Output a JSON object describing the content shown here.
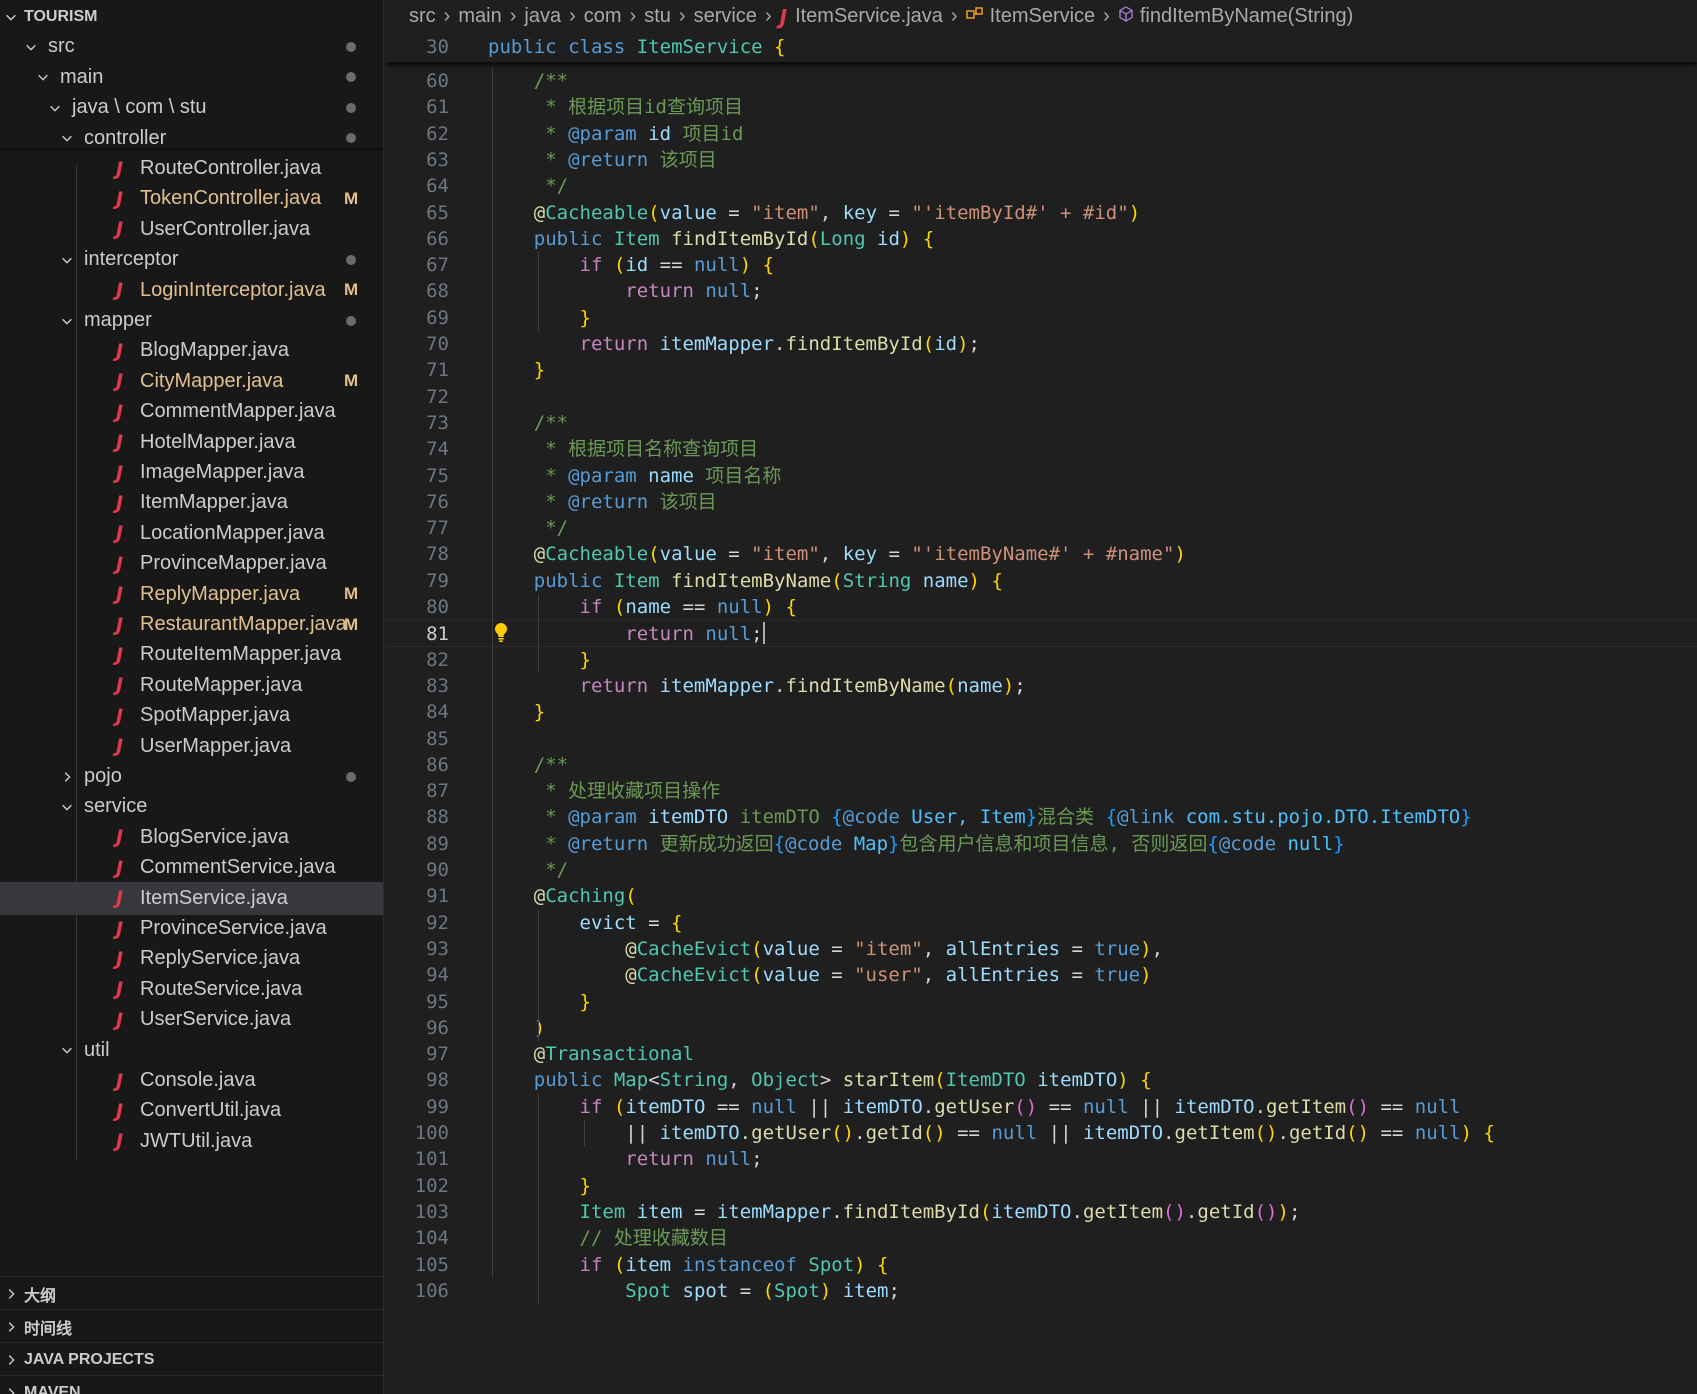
{
  "explorer": {
    "root": "TOURISM",
    "items": [
      {
        "label": "src",
        "kind": "folder",
        "open": true,
        "dot": true
      },
      {
        "label": "main",
        "kind": "folder",
        "open": true,
        "dot": true
      },
      {
        "label": "java \\ com \\ stu",
        "kind": "folder",
        "open": true,
        "dot": true
      },
      {
        "label": "controller",
        "kind": "folder",
        "open": true,
        "dot": true
      },
      {
        "label": "RouteController.java",
        "kind": "java"
      },
      {
        "label": "TokenController.java",
        "kind": "java",
        "badge": "M"
      },
      {
        "label": "UserController.java",
        "kind": "java"
      },
      {
        "label": "interceptor",
        "kind": "folder",
        "open": true,
        "dot": true
      },
      {
        "label": "LoginInterceptor.java",
        "kind": "java",
        "badge": "M"
      },
      {
        "label": "mapper",
        "kind": "folder",
        "open": true,
        "dot": true
      },
      {
        "label": "BlogMapper.java",
        "kind": "java"
      },
      {
        "label": "CityMapper.java",
        "kind": "java",
        "badge": "M"
      },
      {
        "label": "CommentMapper.java",
        "kind": "java"
      },
      {
        "label": "HotelMapper.java",
        "kind": "java"
      },
      {
        "label": "ImageMapper.java",
        "kind": "java"
      },
      {
        "label": "ItemMapper.java",
        "kind": "java"
      },
      {
        "label": "LocationMapper.java",
        "kind": "java"
      },
      {
        "label": "ProvinceMapper.java",
        "kind": "java"
      },
      {
        "label": "ReplyMapper.java",
        "kind": "java",
        "badge": "M"
      },
      {
        "label": "RestaurantMapper.java",
        "kind": "java",
        "badge": "M"
      },
      {
        "label": "RouteItemMapper.java",
        "kind": "java"
      },
      {
        "label": "RouteMapper.java",
        "kind": "java"
      },
      {
        "label": "SpotMapper.java",
        "kind": "java"
      },
      {
        "label": "UserMapper.java",
        "kind": "java"
      },
      {
        "label": "pojo",
        "kind": "folder",
        "open": false,
        "dot": true
      },
      {
        "label": "service",
        "kind": "folder",
        "open": true
      },
      {
        "label": "BlogService.java",
        "kind": "java"
      },
      {
        "label": "CommentService.java",
        "kind": "java"
      },
      {
        "label": "ItemService.java",
        "kind": "java",
        "selected": true
      },
      {
        "label": "ProvinceService.java",
        "kind": "java"
      },
      {
        "label": "ReplyService.java",
        "kind": "java"
      },
      {
        "label": "RouteService.java",
        "kind": "java"
      },
      {
        "label": "UserService.java",
        "kind": "java"
      },
      {
        "label": "util",
        "kind": "folder",
        "open": true
      },
      {
        "label": "Console.java",
        "kind": "java"
      },
      {
        "label": "ConvertUtil.java",
        "kind": "java"
      },
      {
        "label": "JWTUtil.java",
        "kind": "java"
      }
    ],
    "sections": [
      "大纲",
      "时间线",
      "JAVA PROJECTS",
      "MAVEN"
    ]
  },
  "breadcrumb": {
    "parts": [
      "src",
      "main",
      "java",
      "com",
      "stu",
      "service"
    ],
    "file": "ItemService.java",
    "class": "ItemService",
    "method": "findItemByName(String)"
  },
  "sticky": {
    "line": "30",
    "text": "public class ItemService {"
  },
  "code": {
    "current_line": "81",
    "lines": [
      {
        "n": "60",
        "src": "    /**"
      },
      {
        "n": "61",
        "src": "     * 根据项目id查询项目"
      },
      {
        "n": "62",
        "src": "     * @param id 项目id"
      },
      {
        "n": "63",
        "src": "     * @return 该项目"
      },
      {
        "n": "64",
        "src": "     */"
      },
      {
        "n": "65",
        "src": "    @Cacheable(value = \"item\", key = \"'itemById#' + #id\")"
      },
      {
        "n": "66",
        "src": "    public Item findItemById(Long id) {"
      },
      {
        "n": "67",
        "src": "        if (id == null) {"
      },
      {
        "n": "68",
        "src": "            return null;"
      },
      {
        "n": "69",
        "src": "        }"
      },
      {
        "n": "70",
        "src": "        return itemMapper.findItemById(id);"
      },
      {
        "n": "71",
        "src": "    }"
      },
      {
        "n": "72",
        "src": ""
      },
      {
        "n": "73",
        "src": "    /**"
      },
      {
        "n": "74",
        "src": "     * 根据项目名称查询项目"
      },
      {
        "n": "75",
        "src": "     * @param name 项目名称"
      },
      {
        "n": "76",
        "src": "     * @return 该项目"
      },
      {
        "n": "77",
        "src": "     */"
      },
      {
        "n": "78",
        "src": "    @Cacheable(value = \"item\", key = \"'itemByName#' + #name\")"
      },
      {
        "n": "79",
        "src": "    public Item findItemByName(String name) {"
      },
      {
        "n": "80",
        "src": "        if (name == null) {"
      },
      {
        "n": "81",
        "src": "            return null;"
      },
      {
        "n": "82",
        "src": "        }"
      },
      {
        "n": "83",
        "src": "        return itemMapper.findItemByName(name);"
      },
      {
        "n": "84",
        "src": "    }"
      },
      {
        "n": "85",
        "src": ""
      },
      {
        "n": "86",
        "src": "    /**"
      },
      {
        "n": "87",
        "src": "     * 处理收藏项目操作"
      },
      {
        "n": "88",
        "src": "     * @param itemDTO itemDTO {@code User, Item}混合类 {@link com.stu.pojo.DTO.ItemDTO}"
      },
      {
        "n": "89",
        "src": "     * @return 更新成功返回{@code Map}包含用户信息和项目信息, 否则返回{@code null}"
      },
      {
        "n": "90",
        "src": "     */"
      },
      {
        "n": "91",
        "src": "    @Caching("
      },
      {
        "n": "92",
        "src": "        evict = {"
      },
      {
        "n": "93",
        "src": "            @CacheEvict(value = \"item\", allEntries = true),"
      },
      {
        "n": "94",
        "src": "            @CacheEvict(value = \"user\", allEntries = true)"
      },
      {
        "n": "95",
        "src": "        }"
      },
      {
        "n": "96",
        "src": "    )"
      },
      {
        "n": "97",
        "src": "    @Transactional"
      },
      {
        "n": "98",
        "src": "    public Map<String, Object> starItem(ItemDTO itemDTO) {"
      },
      {
        "n": "99",
        "src": "        if (itemDTO == null || itemDTO.getUser() == null || itemDTO.getItem() == null"
      },
      {
        "n": "100",
        "src": "            || itemDTO.getUser().getId() == null || itemDTO.getItem().getId() == null) {"
      },
      {
        "n": "101",
        "src": "            return null;"
      },
      {
        "n": "102",
        "src": "        }"
      },
      {
        "n": "103",
        "src": "        Item item = itemMapper.findItemById(itemDTO.getItem().getId());"
      },
      {
        "n": "104",
        "src": "        // 处理收藏数目"
      },
      {
        "n": "105",
        "src": "        if (item instanceof Spot) {"
      },
      {
        "n": "106",
        "src": "            Spot spot = (Spot) item;"
      }
    ]
  }
}
